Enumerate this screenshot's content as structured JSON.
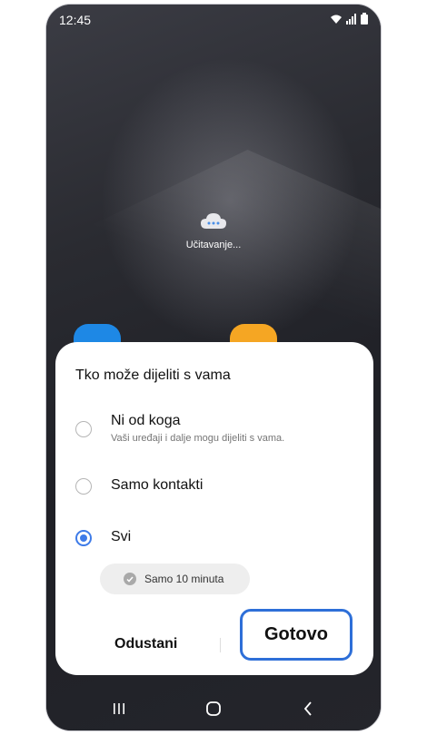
{
  "status_bar": {
    "time": "12:45",
    "icons": [
      "wifi-icon",
      "signal-icon",
      "battery-icon"
    ]
  },
  "home": {
    "loading_text": "Učitavanje...",
    "loading_icon": "cloud-icon"
  },
  "dialog": {
    "title": "Tko može dijeliti s vama",
    "options": [
      {
        "label": "Ni od koga",
        "description": "Vaši uređaji i dalje mogu dijeliti s vama.",
        "selected": false
      },
      {
        "label": "Samo kontakti",
        "description": "",
        "selected": false
      },
      {
        "label": "Svi",
        "description": "",
        "selected": true
      }
    ],
    "timer_chip": {
      "label": "Samo 10 minuta",
      "icon": "check-icon"
    },
    "cancel_label": "Odustani",
    "done_label": "Gotovo"
  },
  "navbar": {
    "icons": [
      "recent-apps-icon",
      "home-icon",
      "back-icon"
    ]
  },
  "colors": {
    "accent": "#3e7be8",
    "highlight_border": "#2e6fd8"
  }
}
